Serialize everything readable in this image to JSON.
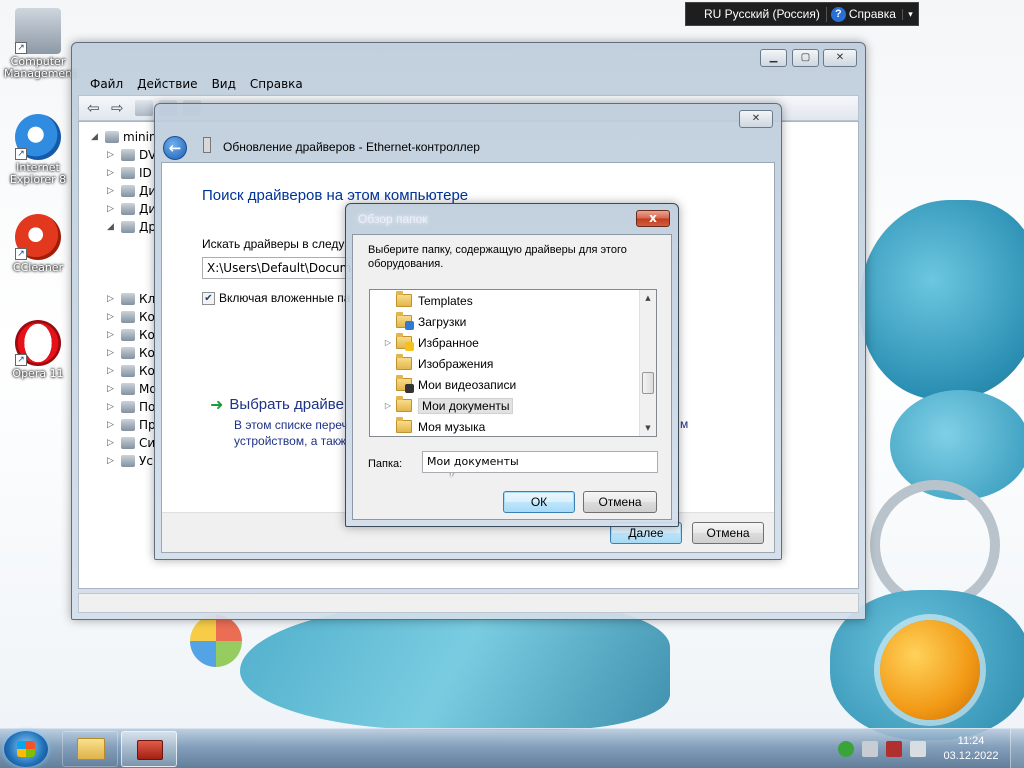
{
  "desktop": {
    "icons": [
      {
        "label": "Computer Management"
      },
      {
        "label": "Internet Explorer 8"
      },
      {
        "label": "CCleaner"
      },
      {
        "label": "Opera 11"
      }
    ]
  },
  "langbar": {
    "language": "RU Русский (Россия)",
    "help": "Справка"
  },
  "device_manager": {
    "menu": [
      "Файл",
      "Действие",
      "Вид",
      "Справка"
    ],
    "tree": {
      "root": "minin",
      "items": [
        "DV",
        "ID",
        "Ди",
        "Ди",
        "Др",
        "Кл",
        "Ко",
        "Ко",
        "Ко",
        "Ко",
        "Мо",
        "По",
        "Пр",
        "Си",
        "Ус"
      ]
    }
  },
  "wizard": {
    "title": "Обновление драйверов - Ethernet-контроллер",
    "heading": "Поиск драйверов на этом компьютере",
    "search_label": "Искать драйверы в следу",
    "path_value": "X:\\Users\\Default\\Documer",
    "include_subfolders": "Включая вложенные па",
    "pick_link": "Выбрать драйве",
    "pick_desc_1": "В этом списке переч",
    "pick_desc_2": "устройством, а такж",
    "pick_desc_tail": "м",
    "next": "Далее",
    "cancel": "Отмена"
  },
  "browse_dialog": {
    "title": "Обзор папок",
    "close_label": "x",
    "instruction": "Выберите папку, содержащую драйверы для этого оборудования.",
    "folders": [
      {
        "label": "Templates",
        "expandable": false
      },
      {
        "label": "Загрузки",
        "expandable": false
      },
      {
        "label": "Избранное",
        "expandable": true
      },
      {
        "label": "Изображения",
        "expandable": false
      },
      {
        "label": "Мои видеозаписи",
        "expandable": false
      },
      {
        "label": "Мои документы",
        "expandable": true,
        "selected": true
      },
      {
        "label": "Моя музыка",
        "expandable": false
      }
    ],
    "folder_label": "Папка:",
    "folder_value": "Мои документы",
    "ok": "ОК",
    "cancel": "Отмена"
  },
  "taskbar": {
    "time": "11:24",
    "date": "03.12.2022"
  },
  "colors": {
    "link_blue": "#1e3287",
    "heading_blue": "#003399"
  }
}
